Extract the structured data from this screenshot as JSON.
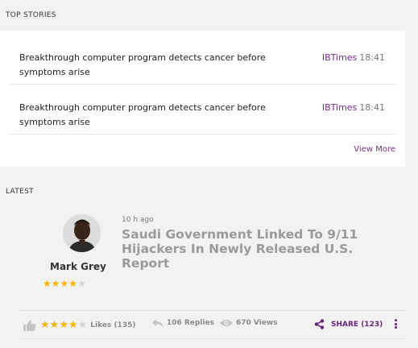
{
  "top_stories": {
    "heading": "TOP STORIES",
    "items": [
      {
        "title": "Breakthrough computer program detects cancer before symptoms arise",
        "source": "IBTimes",
        "time": "18:41"
      },
      {
        "title": "Breakthrough computer program detects cancer before symptoms arise",
        "source": "IBTimes",
        "time": "18:41"
      }
    ],
    "view_more": "View More"
  },
  "latest": {
    "heading": "LATEST",
    "post": {
      "author": "Mark Grey",
      "author_rating": 4,
      "author_rating_max": 5,
      "time_ago": "10 h ago",
      "title": "Saudi Government Linked To 9/11 Hijackers In Newly Released U.S. Report"
    },
    "actions": {
      "post_rating": 4,
      "post_rating_max": 5,
      "likes": "Likes (135)",
      "replies": "106 Replies",
      "views": "670 Views",
      "share": "SHARE (123)"
    }
  },
  "icons": {
    "like": "thumbs-up-icon",
    "reply": "reply-arrow-icon",
    "views": "eye-icon",
    "share": "share-icon",
    "more": "more-vertical-icon"
  },
  "colors": {
    "accent": "#7a2a8a",
    "share": "#6b1f7e",
    "star": "#f5b400",
    "star_empty": "#d5d5d5",
    "post_title": "#9a9a9a",
    "background": "#f2f2f2",
    "panel": "#ffffff"
  }
}
